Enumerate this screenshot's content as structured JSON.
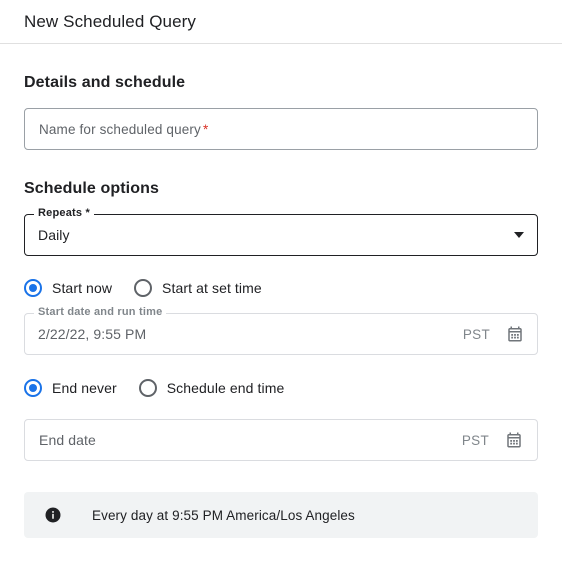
{
  "dialog": {
    "title": "New Scheduled Query"
  },
  "details": {
    "heading": "Details and schedule",
    "name_field": {
      "placeholder": "Name for scheduled query",
      "required_marker": "*",
      "value": ""
    }
  },
  "schedule": {
    "heading": "Schedule options",
    "repeats": {
      "label": "Repeats *",
      "value": "Daily",
      "options": [
        "Daily"
      ],
      "caret_icon": "chevron-down-icon"
    },
    "start_mode": {
      "selected": "start_now",
      "options": [
        {
          "id": "start_now",
          "label": "Start now",
          "checked": true
        },
        {
          "id": "start_at_set_time",
          "label": "Start at set time",
          "checked": false
        }
      ]
    },
    "start_datetime": {
      "label": "Start date and run time",
      "value": "2/22/22, 9:55 PM",
      "timezone": "PST",
      "calendar_icon": "calendar-icon",
      "disabled": true
    },
    "end_mode": {
      "selected": "end_never",
      "options": [
        {
          "id": "end_never",
          "label": "End never",
          "checked": true
        },
        {
          "id": "schedule_end_time",
          "label": "Schedule end time",
          "checked": false
        }
      ]
    },
    "end_date": {
      "placeholder": "End date",
      "value": "",
      "timezone": "PST",
      "calendar_icon": "calendar-icon"
    }
  },
  "info_banner": {
    "icon": "info-icon",
    "message": "Every day at 9:55 PM America/Los Angeles"
  },
  "colors": {
    "accent_blue": "#1a73e8",
    "required_red": "#d93025",
    "text_primary": "#202124",
    "text_secondary": "#5f6368",
    "border": "#9aa0a6",
    "border_disabled": "#dadce0",
    "banner_bg": "#f1f3f4"
  }
}
